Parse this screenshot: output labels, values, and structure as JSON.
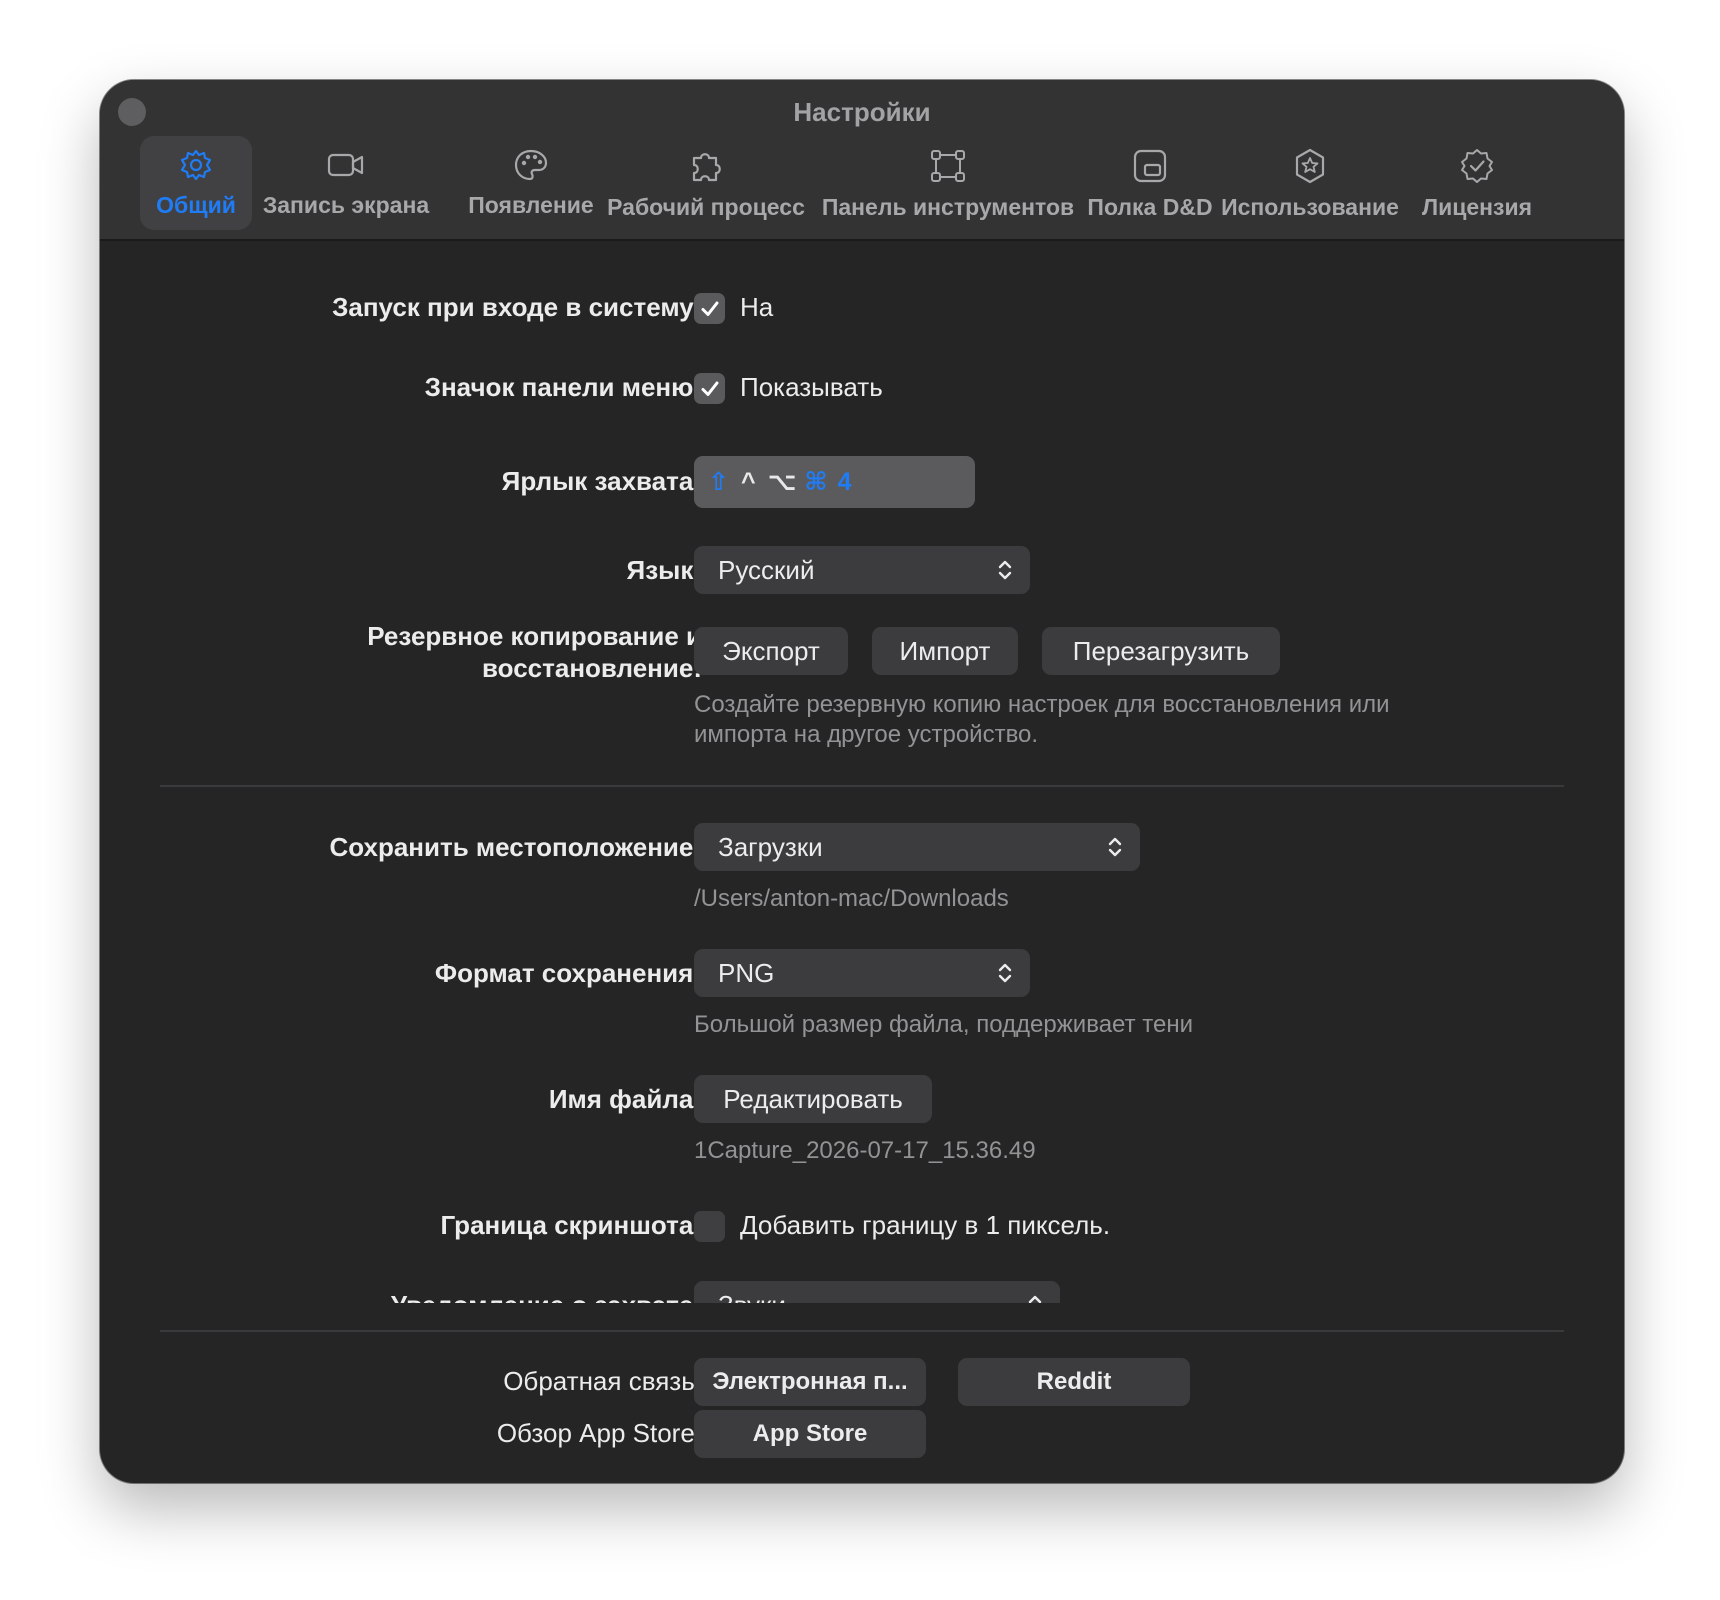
{
  "window": {
    "title": "Настройки"
  },
  "tabs": [
    {
      "label": "Общий",
      "icon": "gear-icon",
      "active": true
    },
    {
      "label": "Запись экрана",
      "icon": "video-camera-icon"
    },
    {
      "label": "Появление",
      "icon": "palette-icon"
    },
    {
      "label": "Рабочий процесс",
      "icon": "puzzle-icon"
    },
    {
      "label": "Панель инструментов",
      "icon": "crop-frame-icon"
    },
    {
      "label": "Полка D&D",
      "icon": "shelf-icon"
    },
    {
      "label": "Использование",
      "icon": "star-badge-icon"
    },
    {
      "label": "Лицензия",
      "icon": "check-badge-icon"
    }
  ],
  "settings": {
    "launch": {
      "label": "Запуск при входе в систему:",
      "checkbox_label": "На",
      "checked": true
    },
    "menu_icon": {
      "label": "Значок панели меню:",
      "checkbox_label": "Показывать",
      "checked": true
    },
    "shortcut": {
      "label": "Ярлык захвата:",
      "keys": [
        "⇧",
        "^",
        "⌥",
        "⌘",
        "4"
      ]
    },
    "language": {
      "label": "Язык:",
      "value": "Русский"
    },
    "backup": {
      "label_line1": "Резервное копирование и",
      "label_line2": "восстановление:",
      "export": "Экспорт",
      "import": "Импорт",
      "reset": "Перезагрузить",
      "hint_line1": "Создайте резервную копию настроек для восстановления или",
      "hint_line2": "импорта на другое устройство."
    },
    "save_location": {
      "label": "Сохранить местоположение:",
      "value": "Загрузки",
      "path": "/Users/anton-mac/Downloads"
    },
    "save_format": {
      "label": "Формат сохранения:",
      "value": "PNG",
      "hint": "Большой размер файла, поддерживает тени"
    },
    "file_name": {
      "label": "Имя файла:",
      "button": "Редактировать",
      "example": "1Capture_2026-07-17_15.36.49"
    },
    "border": {
      "label": "Граница скриншота:",
      "checkbox_label": "Добавить границу в 1 пиксель.",
      "checked": false
    },
    "notification": {
      "label": "Уведомление о захвате:",
      "value": "Звуки"
    }
  },
  "footer": {
    "feedback": {
      "label": "Обратная связь:",
      "email": "Электронная п...",
      "reddit": "Reddit"
    },
    "review": {
      "label": "Обзор App Store:",
      "button": "App Store"
    }
  },
  "colors": {
    "accent": "#1f7cf5",
    "window_bg": "#252526",
    "titlebar_bg": "#333334",
    "control_bg": "#3c3c3e"
  }
}
